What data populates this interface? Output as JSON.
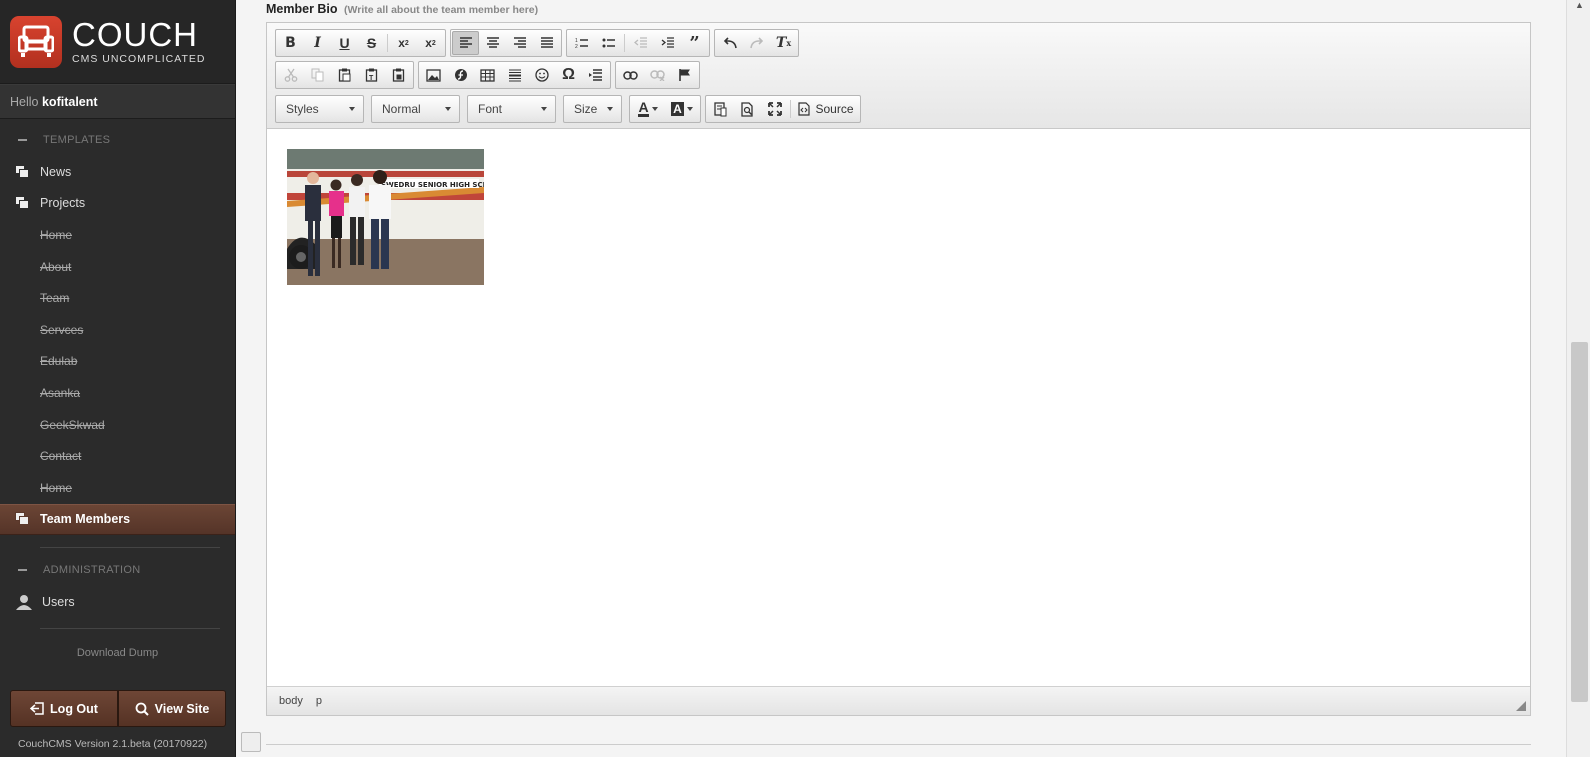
{
  "brand": {
    "name": "COUCH",
    "tagline": "CMS UNCOMPLICATED",
    "accent": "#d0402b"
  },
  "greeting": {
    "hello": "Hello",
    "user": "kofitalent"
  },
  "sidebar": {
    "templates_heading": "TEMPLATES",
    "items": [
      {
        "label": "News",
        "type": "template"
      },
      {
        "label": "Projects",
        "type": "template"
      },
      {
        "label": "Home",
        "type": "child"
      },
      {
        "label": "About",
        "type": "child"
      },
      {
        "label": "Team",
        "type": "child"
      },
      {
        "label": "Servces",
        "type": "child"
      },
      {
        "label": "Edulab",
        "type": "child"
      },
      {
        "label": "Asanka",
        "type": "child"
      },
      {
        "label": "GeekSkwad",
        "type": "child"
      },
      {
        "label": "Contact",
        "type": "child"
      },
      {
        "label": "Home",
        "type": "child"
      },
      {
        "label": "Team Members",
        "type": "active"
      }
    ],
    "admin_heading": "ADMINISTRATION",
    "admin_items": [
      {
        "label": "Users"
      }
    ],
    "download": "Download Dump",
    "logout": "Log Out",
    "view_site": "View Site",
    "version": "CouchCMS Version 2.1.beta (20170922)"
  },
  "field": {
    "label": "Member Bio",
    "hint": "(Write all about the team member here)"
  },
  "toolbar": {
    "styles": "Styles",
    "format": "Normal",
    "font": "Font",
    "size": "Size",
    "source": "Source"
  },
  "statusbar": {
    "path": [
      "body",
      "p"
    ]
  },
  "colors": {
    "sidebar_bg": "#2b2b2b",
    "active_item": "#6b4535"
  }
}
